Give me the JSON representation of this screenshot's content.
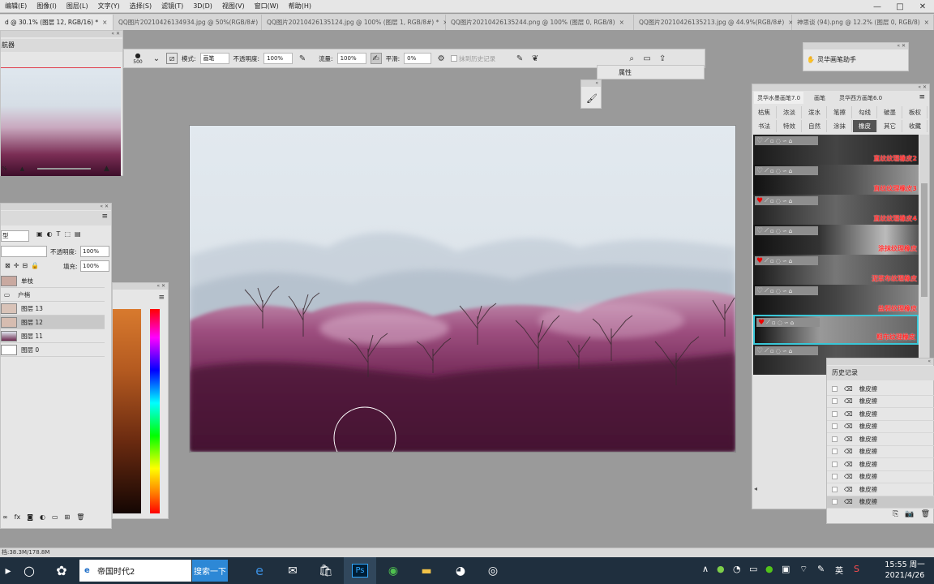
{
  "menubar": {
    "items": [
      "编辑(E)",
      "图像(I)",
      "图层(L)",
      "文字(Y)",
      "选择(S)",
      "滤镜(T)",
      "3D(D)",
      "视图(V)",
      "窗口(W)",
      "帮助(H)"
    ]
  },
  "tabs": [
    {
      "label": "d @ 30.1% (图层 12, RGB/16) *",
      "active": true
    },
    {
      "label": "QQ图片20210426134934.jpg @ 50%(RGB/8#)",
      "active": false
    },
    {
      "label": "QQ图片20210426135124.jpg @ 100% (图层 1, RGB/8#) *",
      "active": false
    },
    {
      "label": "QQ图片20210426135244.png @ 100% (图层 0, RGB/8)",
      "active": false
    },
    {
      "label": "QQ图片20210426135213.jpg @ 44.9%(RGB/8#)",
      "active": false
    },
    {
      "label": "神思谈 (94).png @ 12.2% (图层 0, RGB/8)",
      "active": false
    }
  ],
  "options": {
    "brush_size": "500",
    "mode_label": "模式:",
    "mode_value": "画笔",
    "opacity_label": "不透明度:",
    "opacity_value": "100%",
    "flow_label": "流量:",
    "flow_value": "100%",
    "smooth_label": "平滑:",
    "smooth_value": "0%",
    "history_erase_label": "抹到历史记录"
  },
  "properties": {
    "label": "属性"
  },
  "navigator": {
    "title": "航器",
    "zoom": "%"
  },
  "layers": {
    "kind_value": "型",
    "opacity_label": "不透明度:",
    "opacity_value": "100%",
    "fill_label": "填充:",
    "fill_value": "100%",
    "rows": [
      {
        "name": "单枝",
        "selected": false
      },
      {
        "name": "户梢",
        "selected": false
      },
      {
        "name": "图层 13",
        "selected": false
      },
      {
        "name": "图层 12",
        "selected": true
      },
      {
        "name": "图层 11",
        "selected": false
      },
      {
        "name": "图层 0",
        "selected": false
      }
    ]
  },
  "brushpanel": {
    "tabs": [
      "灵华水墨画笔7.0",
      "画笔",
      "灵华西方画笔6.0"
    ],
    "cat_row1": [
      "枯焦",
      "浓淡",
      "泼水",
      "笔擦",
      "勾线",
      "破墨",
      "板权"
    ],
    "cat_row2": [
      "书法",
      "特效",
      "自然",
      "涂抹",
      "橡皮",
      "其它",
      "收藏"
    ],
    "active_cat": "橡皮",
    "brushes": [
      {
        "label": "直纹纹理橡皮2",
        "heart": false,
        "selected": false
      },
      {
        "label": "直纹纹理橡皮3",
        "heart": false,
        "selected": false
      },
      {
        "label": "直纹纹理橡皮4",
        "heart": true,
        "selected": false
      },
      {
        "label": "涂抹纹理橡皮",
        "heart": false,
        "selected": false
      },
      {
        "label": "泥浆布纹理橡皮",
        "heart": true,
        "selected": false
      },
      {
        "label": "盐裂纹理橡皮",
        "heart": false,
        "selected": false
      },
      {
        "label": "粗布纹理橡皮",
        "heart": true,
        "selected": true
      },
      {
        "label": "干刷纹理橡皮",
        "heart": false,
        "selected": false
      }
    ]
  },
  "lhpanel": {
    "label": "灵华画笔助手"
  },
  "history": {
    "title": "历史记录",
    "rows": [
      "橡皮擦",
      "橡皮擦",
      "橡皮擦",
      "橡皮擦",
      "橡皮擦",
      "橡皮擦",
      "橡皮擦",
      "橡皮擦",
      "橡皮擦",
      "橡皮擦"
    ],
    "selected_index": 9
  },
  "statusbar": {
    "text": "档:38.3M/178.8M"
  },
  "taskbar": {
    "search_value": "帝国时代2",
    "search_button": "搜索一下",
    "time": "15:55 周一",
    "date": "2021/4/26",
    "ime": "英"
  },
  "colors": {
    "accent_select": "#39c6d7",
    "brush_label": "#ff2b2b",
    "taskbar_bg": "#1f2f3e"
  }
}
